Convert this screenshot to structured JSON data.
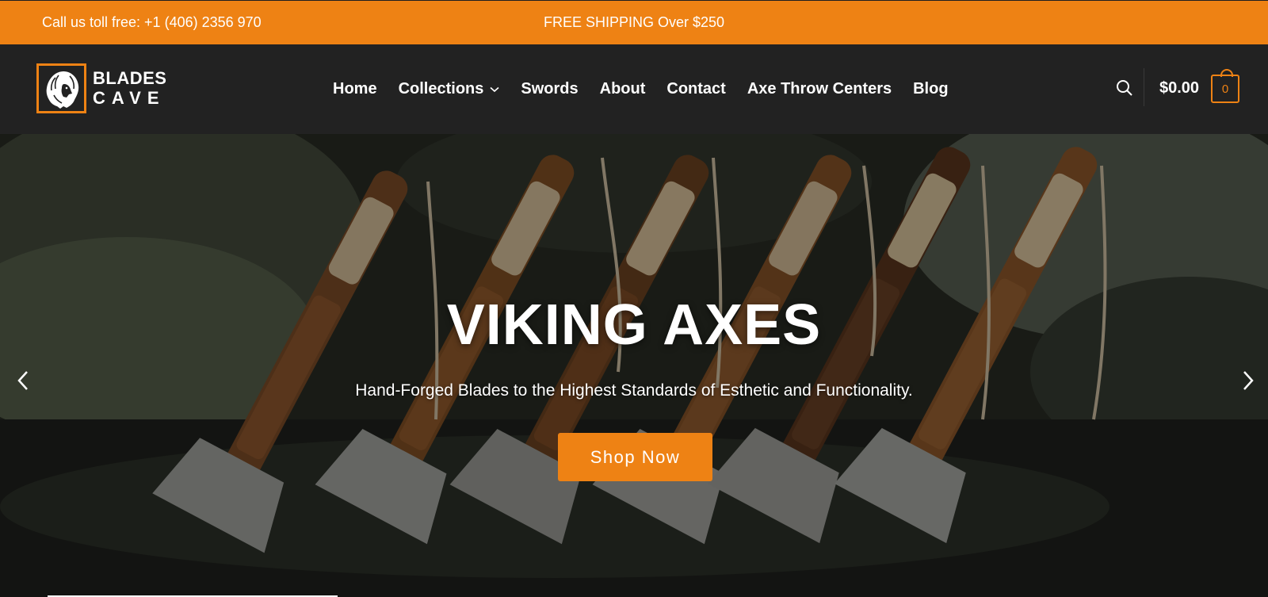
{
  "topbar": {
    "phone_text": "Call us toll free: +1 (406) 2356 970",
    "shipping_text": "FREE SHIPPING Over $250",
    "bg_color": "#ee8214"
  },
  "header": {
    "logo": {
      "line1": "BLADES",
      "line2": "CAVE",
      "icon": "lion-head-icon"
    },
    "nav": [
      {
        "label": "Home"
      },
      {
        "label": "Collections",
        "has_dropdown": true
      },
      {
        "label": "Swords"
      },
      {
        "label": "About"
      },
      {
        "label": "Contact"
      },
      {
        "label": "Axe Throw Centers"
      },
      {
        "label": "Blog"
      }
    ],
    "search_icon": "search-icon",
    "cart_total": "$0.00",
    "cart_count": "0",
    "accent_color": "#ee8214"
  },
  "hero": {
    "title": "VIKING AXES",
    "subtitle": "Hand-Forged Blades to the Highest Standards of Esthetic and Functionality.",
    "cta_label": "Shop Now",
    "prev_icon": "chevron-left-icon",
    "next_icon": "chevron-right-icon"
  }
}
